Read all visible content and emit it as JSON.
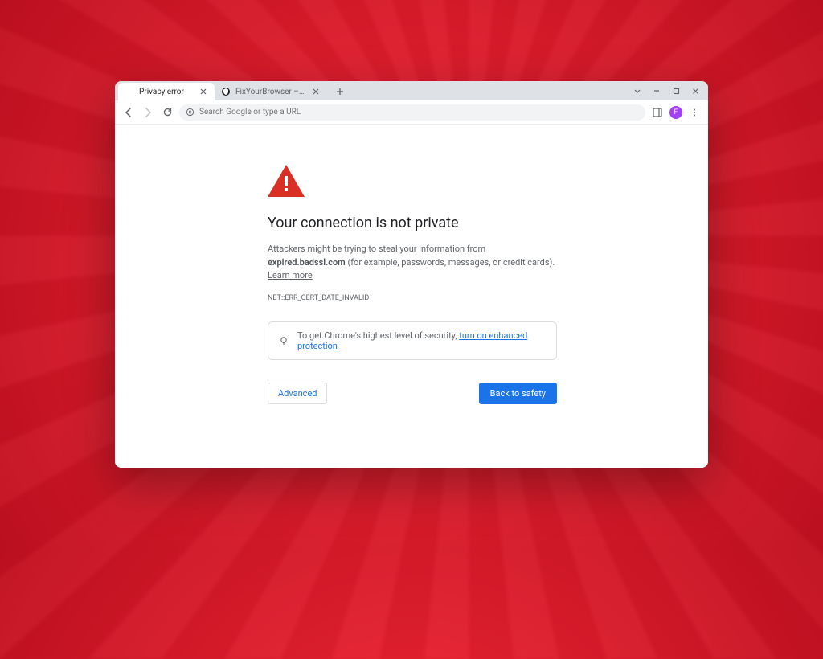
{
  "tabs": [
    {
      "label": "Privacy error",
      "active": true,
      "favicon": "blank"
    },
    {
      "label": "FixYourBrowser – Your Trusted S...",
      "active": false,
      "favicon": "shield"
    }
  ],
  "window_controls": {
    "dropdown": "⌄",
    "minimize": "−",
    "maximize": "☐",
    "close": "✕"
  },
  "toolbar": {
    "search_engine_icon": "G",
    "omnibox_placeholder": "Search Google or type a URL"
  },
  "profile": {
    "initial": "F"
  },
  "page": {
    "heading": "Your connection is not private",
    "body_prefix": "Attackers might be trying to steal your information from ",
    "domain": "expired.badssl.com",
    "body_suffix": " (for example, passwords, messages, or credit cards). ",
    "learn_more": "Learn more",
    "error_code": "NET::ERR_CERT_DATE_INVALID",
    "tip_prefix": "To get Chrome's highest level of security, ",
    "tip_link": "turn on enhanced protection",
    "advanced_label": "Advanced",
    "primary_label": "Back to safety"
  }
}
